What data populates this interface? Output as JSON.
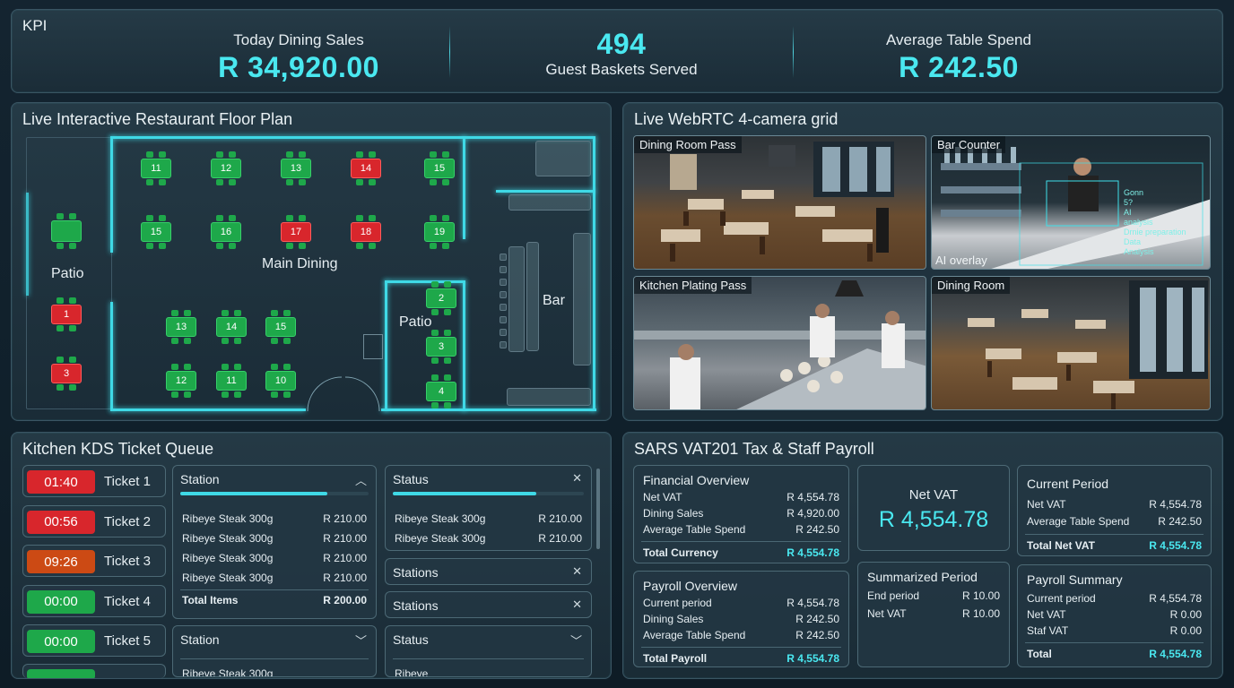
{
  "kpi": {
    "title": "KPI",
    "today_label": "Today Dining Sales",
    "today_value": "R 34,920.00",
    "baskets_value": "494",
    "baskets_label": "Guest Baskets Served",
    "avg_label": "Average Table Spend",
    "avg_value": "R 242.50"
  },
  "floor": {
    "title": "Live Interactive Restaurant Floor Plan",
    "patio_left": "Patio",
    "main": "Main Dining",
    "patio_inner": "Patio",
    "bar": "Bar",
    "tables": {
      "t11a": "11",
      "t12a": "12",
      "t13a": "13",
      "t14a": "14",
      "t15a": "15",
      "t15b": "15",
      "t16": "16",
      "t17": "17",
      "t18": "18",
      "t19": "19",
      "t13b": "13",
      "t14b": "14",
      "t15c": "15",
      "t12b": "12",
      "t11b": "11",
      "t10": "10",
      "p1": "1",
      "p3": "3",
      "i2": "2",
      "i3": "3",
      "i4": "4"
    }
  },
  "cams": {
    "title": "Live WebRTC 4-camera grid",
    "c1": "Dining Room Pass",
    "c2": "Bar Counter",
    "c2_overlay": "AI overlay",
    "c2_ai": [
      "Gonn",
      "5?",
      "AI",
      "analysis",
      "Drnie preparation",
      "Data",
      "Analysis"
    ],
    "c3": "Kitchen Plating Pass",
    "c4": "Dining Room"
  },
  "kds": {
    "title": "Kitchen KDS Ticket Queue",
    "tickets": [
      {
        "time": "01:40",
        "label": "Ticket 1",
        "color": "#d8262c"
      },
      {
        "time": "00:56",
        "label": "Ticket 2",
        "color": "#d8262c"
      },
      {
        "time": "09:26",
        "label": "Ticket 3",
        "color": "#cc4a14"
      },
      {
        "time": "00:00",
        "label": "Ticket 4",
        "color": "#1ea84a"
      },
      {
        "time": "00:00",
        "label": "Ticket 5",
        "color": "#1ea84a"
      }
    ],
    "station": {
      "header": "Station",
      "rows": [
        [
          "Ribeye Steak 300g",
          "R 210.00"
        ],
        [
          "Ribeye Steak 300g",
          "R 210.00"
        ],
        [
          "Ribeye Steak 300g",
          "R 210.00"
        ],
        [
          "Ribeye Steak 300g",
          "R 210.00"
        ]
      ],
      "total_label": "Total Items",
      "total_value": "R 200.00",
      "progress": 0.78
    },
    "status": {
      "header": "Status",
      "rows": [
        [
          "Ribeye Steak 300g",
          "R 210.00"
        ],
        [
          "Ribeye Steak 300g",
          "R 210.00"
        ]
      ],
      "progress": 0.75
    },
    "stations1": "Stations",
    "stations2": "Stations",
    "station2": "Station",
    "status2": "Status",
    "station2_peek": "Ribeye Steak 300g",
    "status2_peek": "Ribeye"
  },
  "vat": {
    "title": "SARS VAT201 Tax & Staff Payroll",
    "fin": {
      "header": "Financial Overview",
      "rows": [
        [
          "Net VAT",
          "R 4,554.78"
        ],
        [
          "Dining Sales",
          "R 4,920.00"
        ],
        [
          "Average Table Spend",
          "R 242.50"
        ]
      ],
      "total": [
        "Total Currency",
        "R 4,554.78"
      ]
    },
    "netvat": {
      "header": "Net VAT",
      "value": "R 4,554.78"
    },
    "cur": {
      "header": "Current Period",
      "rows": [
        [
          "Net VAT",
          "R 4,554.78"
        ],
        [
          "Average Table Spend",
          "R 242.50"
        ]
      ],
      "total": [
        "Total Net VAT",
        "R 4,554.78"
      ]
    },
    "pay": {
      "header": "Payroll Overview",
      "rows": [
        [
          "Current period",
          "R 4,554.78"
        ],
        [
          "Dining Sales",
          "R 242.50"
        ],
        [
          "Average Table Spend",
          "R 242.50"
        ]
      ],
      "total": [
        "Total Payroll",
        "R 4,554.78"
      ]
    },
    "sum": {
      "header": "Summarized Period",
      "rows": [
        [
          "End period",
          "R 10.00"
        ],
        [
          "Net VAT",
          "R 10.00"
        ]
      ]
    },
    "psum": {
      "header": "Payroll Summary",
      "rows": [
        [
          "Current period",
          "R 4,554.78"
        ],
        [
          "Net VAT",
          "R 0.00"
        ],
        [
          "Staf VAT",
          "R 0.00"
        ]
      ],
      "total": [
        "Total",
        "R 4,554.78"
      ]
    }
  }
}
